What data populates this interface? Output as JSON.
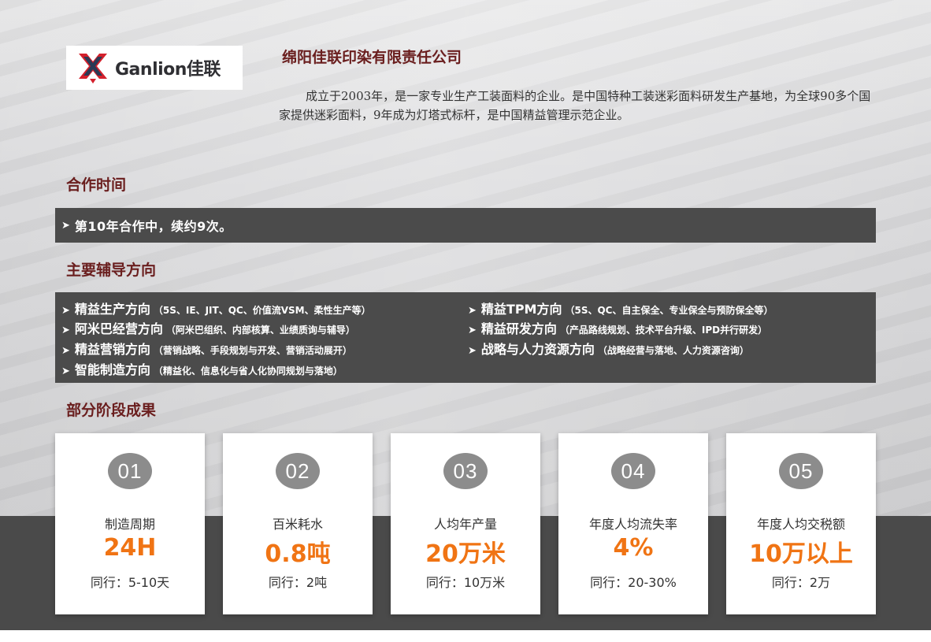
{
  "logo": {
    "brand": "Ganlion佳联"
  },
  "company": {
    "name": "绵阳佳联印染有限责任公司",
    "intro": "成立于2003年，是一家专业生产工装面料的企业。是中国特种工装迷彩面料研发生产基地，为全球90多个国家提供迷彩面料，9年成为灯塔式标杆，是中国精益管理示范企业。"
  },
  "sections": {
    "cooperation": {
      "title": "合作时间",
      "text": "第10年合作中，续约9次。"
    },
    "directions": {
      "title": "主要辅导方向",
      "items": [
        {
          "main": "精益生产方向",
          "sub": "（5S、IE、JIT、QC、价值流VSM、柔性生产等）"
        },
        {
          "main": "精益TPM方向",
          "sub": "（5S、QC、自主保全、专业保全与预防保全等）"
        },
        {
          "main": "阿米巴经营方向",
          "sub": "（阿米巴组织、内部核算、业绩质询与辅导）"
        },
        {
          "main": "精益研发方向",
          "sub": "（产品路线规划、技术平台升级、IPD并行研发）"
        },
        {
          "main": "精益营销方向",
          "sub": "（营销战略、手段规划与开发、营销活动展开）"
        },
        {
          "main": "战略与人力资源方向",
          "sub": "（战略经营与落地、人力资源咨询）"
        },
        {
          "main": "智能制造方向",
          "sub": "（精益化、信息化与省人化协同规划与落地）"
        }
      ]
    },
    "results": {
      "title": "部分阶段成果",
      "cards": [
        {
          "num": "01",
          "label": "制造周期",
          "value": "24H",
          "peer": "同行：5-10天"
        },
        {
          "num": "02",
          "label": "百米耗水",
          "value": "0.8吨",
          "peer": "同行：2吨"
        },
        {
          "num": "03",
          "label": "人均年产量",
          "value": "20万米",
          "peer": "同行：10万米"
        },
        {
          "num": "04",
          "label": "年度人均流失率",
          "value": "4%",
          "peer": "同行：20-30%"
        },
        {
          "num": "05",
          "label": "年度人均交税额",
          "value": "10万以上",
          "peer": "同行：2万"
        }
      ]
    }
  },
  "colors": {
    "accent": "#f07414",
    "title": "#6a1e1e",
    "bar": "#4b4b4b",
    "logo_red": "#d4202c"
  },
  "icons": {
    "bullet": "arrow-right-icon",
    "logo": "ganlion-logo-mark"
  }
}
